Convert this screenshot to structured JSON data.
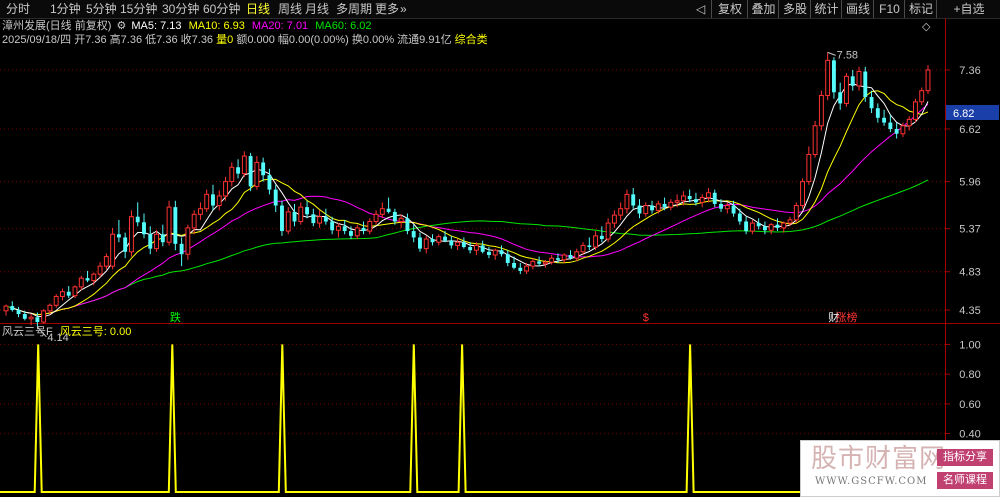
{
  "toolbar": {
    "periods": [
      {
        "label": "分时",
        "active": false
      },
      {
        "label": "1分钟",
        "active": false
      },
      {
        "label": "5分钟",
        "active": false
      },
      {
        "label": "15分钟",
        "active": false
      },
      {
        "label": "30分钟",
        "active": false
      },
      {
        "label": "60分钟",
        "active": false
      },
      {
        "label": "日线",
        "active": true
      },
      {
        "label": "周线",
        "active": false
      },
      {
        "label": "月线",
        "active": false
      },
      {
        "label": "多周期",
        "active": false
      },
      {
        "label": "更多",
        "active": false
      }
    ],
    "more_arrow": "»",
    "right_buttons": [
      "复权",
      "叠加",
      "多股",
      "统计",
      "画线",
      "F10",
      "标记",
      "+自选"
    ],
    "nav_arrow": "◁"
  },
  "main_chart": {
    "stock_title": "漳州发展(日线 前复权)",
    "ma5_label": "MA5: 7.13",
    "ma10_label": "MA10: 6.93",
    "ma20_label": "MA20: 7.01",
    "ma60_label": "MA60: 6.02",
    "date": "2025/09/18/四",
    "open_k": "开",
    "open_v": "7.36",
    "high_k": "高",
    "high_v": "7.36",
    "low_k": "低",
    "low_v": "7.36",
    "close_k": "收",
    "close_v": "7.36",
    "vol_k": "量",
    "vol_v": "0",
    "amt_k": "额",
    "amt_v": "0.000",
    "chg_k": "幅",
    "chg_v": "0.00(0.00%)",
    "turn_k": "换",
    "turn_v": "0.00%",
    "float_k": "流通",
    "float_v": "9.91亿",
    "category": "综合类",
    "diamond_icon": "◇"
  },
  "colors": {
    "up": "#ff3232",
    "down": "#54fcfc",
    "ma5": "#ffffff",
    "ma10": "#ffff00",
    "ma20": "#ff00ff",
    "ma60": "#00e600",
    "grid": "#800000",
    "axis_text": "#c8c8c8",
    "indicator": "#ffff00"
  },
  "chart_data": [
    {
      "type": "candlestick",
      "title": "",
      "y_ticks": [
        7.36,
        6.62,
        5.96,
        5.37,
        4.83,
        4.35
      ],
      "y_range": [
        4.2,
        7.66
      ],
      "current_price_label": "6.82",
      "high_annotation": "7.58",
      "low_annotation": "4.14",
      "high_value": 7.58,
      "low_value": 4.14,
      "event_markers": [
        {
          "text": "跌",
          "color": "#00ff00",
          "index": 27
        },
        {
          "text": "$",
          "color": "#ff3232",
          "index": 102
        },
        {
          "text": "财",
          "color": "#ffffff",
          "index": 132
        },
        {
          "text": "涨榜",
          "color": "#ff3232",
          "index": 134
        }
      ],
      "ohlc": [
        [
          4.34,
          4.42,
          4.28,
          4.4
        ],
        [
          4.4,
          4.46,
          4.33,
          4.35
        ],
        [
          4.35,
          4.39,
          4.26,
          4.3
        ],
        [
          4.3,
          4.34,
          4.22,
          4.24
        ],
        [
          4.24,
          4.3,
          4.16,
          4.26
        ],
        [
          4.26,
          4.32,
          4.14,
          4.2
        ],
        [
          4.2,
          4.36,
          4.18,
          4.34
        ],
        [
          4.34,
          4.43,
          4.3,
          4.41
        ],
        [
          4.41,
          4.55,
          4.38,
          4.52
        ],
        [
          4.52,
          4.62,
          4.47,
          4.58
        ],
        [
          4.58,
          4.65,
          4.5,
          4.53
        ],
        [
          4.53,
          4.66,
          4.5,
          4.64
        ],
        [
          4.64,
          4.78,
          4.6,
          4.75
        ],
        [
          4.75,
          4.84,
          4.7,
          4.72
        ],
        [
          4.72,
          4.82,
          4.66,
          4.8
        ],
        [
          4.8,
          4.95,
          4.76,
          4.9
        ],
        [
          4.9,
          5.06,
          4.86,
          5.02
        ],
        [
          4.9,
          5.38,
          4.86,
          5.3
        ],
        [
          5.3,
          5.48,
          5.2,
          5.26
        ],
        [
          5.26,
          5.32,
          5.0,
          5.08
        ],
        [
          5.08,
          5.6,
          5.02,
          5.52
        ],
        [
          5.52,
          5.7,
          5.4,
          5.45
        ],
        [
          5.45,
          5.56,
          5.25,
          5.3
        ],
        [
          5.3,
          5.4,
          5.05,
          5.12
        ],
        [
          5.12,
          5.35,
          5.08,
          5.3
        ],
        [
          5.3,
          5.42,
          5.15,
          5.2
        ],
        [
          5.2,
          5.72,
          5.16,
          5.64
        ],
        [
          5.64,
          5.72,
          5.1,
          5.18
        ],
        [
          5.18,
          5.26,
          4.9,
          5.05
        ],
        [
          5.05,
          5.42,
          4.98,
          5.38
        ],
        [
          5.38,
          5.6,
          5.3,
          5.55
        ],
        [
          5.55,
          5.7,
          5.48,
          5.62
        ],
        [
          5.62,
          5.86,
          5.58,
          5.8
        ],
        [
          5.8,
          5.92,
          5.6,
          5.66
        ],
        [
          5.66,
          5.85,
          5.6,
          5.78
        ],
        [
          5.78,
          6.02,
          5.72,
          5.96
        ],
        [
          5.96,
          6.2,
          5.9,
          6.14
        ],
        [
          6.14,
          6.24,
          6.0,
          6.06
        ],
        [
          6.06,
          6.34,
          6.02,
          6.28
        ],
        [
          6.28,
          6.32,
          5.84,
          5.9
        ],
        [
          5.9,
          6.28,
          5.86,
          6.2
        ],
        [
          6.2,
          6.26,
          5.96,
          6.04
        ],
        [
          6.04,
          6.12,
          5.8,
          5.86
        ],
        [
          5.86,
          5.92,
          5.58,
          5.66
        ],
        [
          5.66,
          5.72,
          5.28,
          5.34
        ],
        [
          5.34,
          5.64,
          5.3,
          5.58
        ],
        [
          5.58,
          5.68,
          5.4,
          5.46
        ],
        [
          5.46,
          5.7,
          5.42,
          5.64
        ],
        [
          5.64,
          5.72,
          5.5,
          5.55
        ],
        [
          5.55,
          5.62,
          5.4,
          5.44
        ],
        [
          5.44,
          5.6,
          5.38,
          5.52
        ],
        [
          5.52,
          5.62,
          5.42,
          5.46
        ],
        [
          5.46,
          5.52,
          5.3,
          5.35
        ],
        [
          5.35,
          5.44,
          5.26,
          5.4
        ],
        [
          5.4,
          5.48,
          5.3,
          5.34
        ],
        [
          5.34,
          5.4,
          5.24,
          5.28
        ],
        [
          5.28,
          5.42,
          5.24,
          5.38
        ],
        [
          5.38,
          5.46,
          5.3,
          5.34
        ],
        [
          5.34,
          5.5,
          5.3,
          5.46
        ],
        [
          5.46,
          5.6,
          5.42,
          5.55
        ],
        [
          5.55,
          5.7,
          5.5,
          5.62
        ],
        [
          5.62,
          5.76,
          5.56,
          5.58
        ],
        [
          5.58,
          5.62,
          5.42,
          5.46
        ],
        [
          5.46,
          5.55,
          5.38,
          5.5
        ],
        [
          5.5,
          5.56,
          5.3,
          5.34
        ],
        [
          5.34,
          5.42,
          5.2,
          5.26
        ],
        [
          5.26,
          5.32,
          5.08,
          5.12
        ],
        [
          5.12,
          5.28,
          5.06,
          5.24
        ],
        [
          5.24,
          5.3,
          5.16,
          5.2
        ],
        [
          5.2,
          5.3,
          5.16,
          5.27
        ],
        [
          5.27,
          5.34,
          5.2,
          5.22
        ],
        [
          5.22,
          5.28,
          5.12,
          5.16
        ],
        [
          5.16,
          5.24,
          5.1,
          5.2
        ],
        [
          5.2,
          5.26,
          5.12,
          5.14
        ],
        [
          5.14,
          5.2,
          5.06,
          5.1
        ],
        [
          5.1,
          5.2,
          5.04,
          5.16
        ],
        [
          5.16,
          5.22,
          5.06,
          5.08
        ],
        [
          5.08,
          5.14,
          5.0,
          5.04
        ],
        [
          5.04,
          5.12,
          4.98,
          5.1
        ],
        [
          5.1,
          5.16,
          5.02,
          5.05
        ],
        [
          5.05,
          5.1,
          4.9,
          4.94
        ],
        [
          4.94,
          5.02,
          4.86,
          4.88
        ],
        [
          4.88,
          4.94,
          4.8,
          4.84
        ],
        [
          4.84,
          4.94,
          4.8,
          4.9
        ],
        [
          4.9,
          5.0,
          4.86,
          4.96
        ],
        [
          4.96,
          5.02,
          4.9,
          4.93
        ],
        [
          4.93,
          4.98,
          4.88,
          4.95
        ],
        [
          4.95,
          5.04,
          4.92,
          5.0
        ],
        [
          5.0,
          5.06,
          4.94,
          4.98
        ],
        [
          4.98,
          5.06,
          4.94,
          5.04
        ],
        [
          5.04,
          5.1,
          4.98,
          5.0
        ],
        [
          5.0,
          5.12,
          4.96,
          5.08
        ],
        [
          5.08,
          5.2,
          5.04,
          5.16
        ],
        [
          5.16,
          5.26,
          5.1,
          5.14
        ],
        [
          5.14,
          5.34,
          5.1,
          5.28
        ],
        [
          5.28,
          5.4,
          5.2,
          5.24
        ],
        [
          5.24,
          5.5,
          5.2,
          5.44
        ],
        [
          5.44,
          5.6,
          5.38,
          5.54
        ],
        [
          5.54,
          5.7,
          5.48,
          5.62
        ],
        [
          5.62,
          5.86,
          5.56,
          5.8
        ],
        [
          5.8,
          5.88,
          5.62,
          5.66
        ],
        [
          5.66,
          5.74,
          5.5,
          5.56
        ],
        [
          5.56,
          5.7,
          5.52,
          5.66
        ],
        [
          5.66,
          5.72,
          5.56,
          5.6
        ],
        [
          5.6,
          5.72,
          5.56,
          5.68
        ],
        [
          5.68,
          5.76,
          5.6,
          5.64
        ],
        [
          5.64,
          5.74,
          5.6,
          5.7
        ],
        [
          5.7,
          5.8,
          5.64,
          5.72
        ],
        [
          5.72,
          5.84,
          5.66,
          5.78
        ],
        [
          5.78,
          5.86,
          5.7,
          5.74
        ],
        [
          5.74,
          5.82,
          5.66,
          5.7
        ],
        [
          5.7,
          5.8,
          5.64,
          5.76
        ],
        [
          5.76,
          5.88,
          5.7,
          5.82
        ],
        [
          5.82,
          5.86,
          5.64,
          5.68
        ],
        [
          5.68,
          5.74,
          5.58,
          5.62
        ],
        [
          5.62,
          5.7,
          5.56,
          5.66
        ],
        [
          5.66,
          5.72,
          5.52,
          5.56
        ],
        [
          5.56,
          5.62,
          5.42,
          5.46
        ],
        [
          5.46,
          5.52,
          5.3,
          5.34
        ],
        [
          5.34,
          5.48,
          5.3,
          5.44
        ],
        [
          5.44,
          5.5,
          5.36,
          5.4
        ],
        [
          5.4,
          5.46,
          5.3,
          5.35
        ],
        [
          5.35,
          5.44,
          5.3,
          5.42
        ],
        [
          5.42,
          5.5,
          5.34,
          5.38
        ],
        [
          5.38,
          5.46,
          5.32,
          5.44
        ],
        [
          5.44,
          5.52,
          5.4,
          5.48
        ],
        [
          5.48,
          5.7,
          5.44,
          5.66
        ],
        [
          5.66,
          6.0,
          5.62,
          5.96
        ],
        [
          5.96,
          6.4,
          5.92,
          6.3
        ],
        [
          6.3,
          6.72,
          6.26,
          6.66
        ],
        [
          6.66,
          7.1,
          6.6,
          7.04
        ],
        [
          7.04,
          7.58,
          6.98,
          7.48
        ],
        [
          7.48,
          7.52,
          7.0,
          7.08
        ],
        [
          7.08,
          7.2,
          6.86,
          6.94
        ],
        [
          6.94,
          7.32,
          6.9,
          7.28
        ],
        [
          7.28,
          7.36,
          7.1,
          7.16
        ],
        [
          7.16,
          7.4,
          7.1,
          7.34
        ],
        [
          7.34,
          7.4,
          6.96,
          7.02
        ],
        [
          7.02,
          7.1,
          6.82,
          6.88
        ],
        [
          6.88,
          6.94,
          6.7,
          6.76
        ],
        [
          6.76,
          6.86,
          6.66,
          6.7
        ],
        [
          6.7,
          6.8,
          6.58,
          6.62
        ],
        [
          6.62,
          6.7,
          6.5,
          6.56
        ],
        [
          6.56,
          6.7,
          6.52,
          6.66
        ],
        [
          6.66,
          6.78,
          6.6,
          6.74
        ],
        [
          6.74,
          7.0,
          6.7,
          6.96
        ],
        [
          6.96,
          7.14,
          6.92,
          7.1
        ],
        [
          7.1,
          7.42,
          7.06,
          7.36
        ]
      ]
    },
    {
      "type": "line",
      "indicator_name": "风云三号F",
      "series_label": "风云三号: 0.00",
      "y_ticks": [
        1.0,
        0.8,
        0.6,
        0.4
      ],
      "y_range": [
        0,
        1.05
      ],
      "signal_indices": [
        12,
        62,
        103,
        152,
        170,
        255
      ],
      "signal_index_range": [
        0,
        350
      ],
      "series": [
        {
          "name": "风云三号",
          "values_note_last": 0.0
        }
      ]
    }
  ],
  "watermark": {
    "main_text": "股市财富网",
    "url_text": "WWW.GSCFW.COM",
    "badge1": "指标分享",
    "badge2": "名师课程"
  }
}
